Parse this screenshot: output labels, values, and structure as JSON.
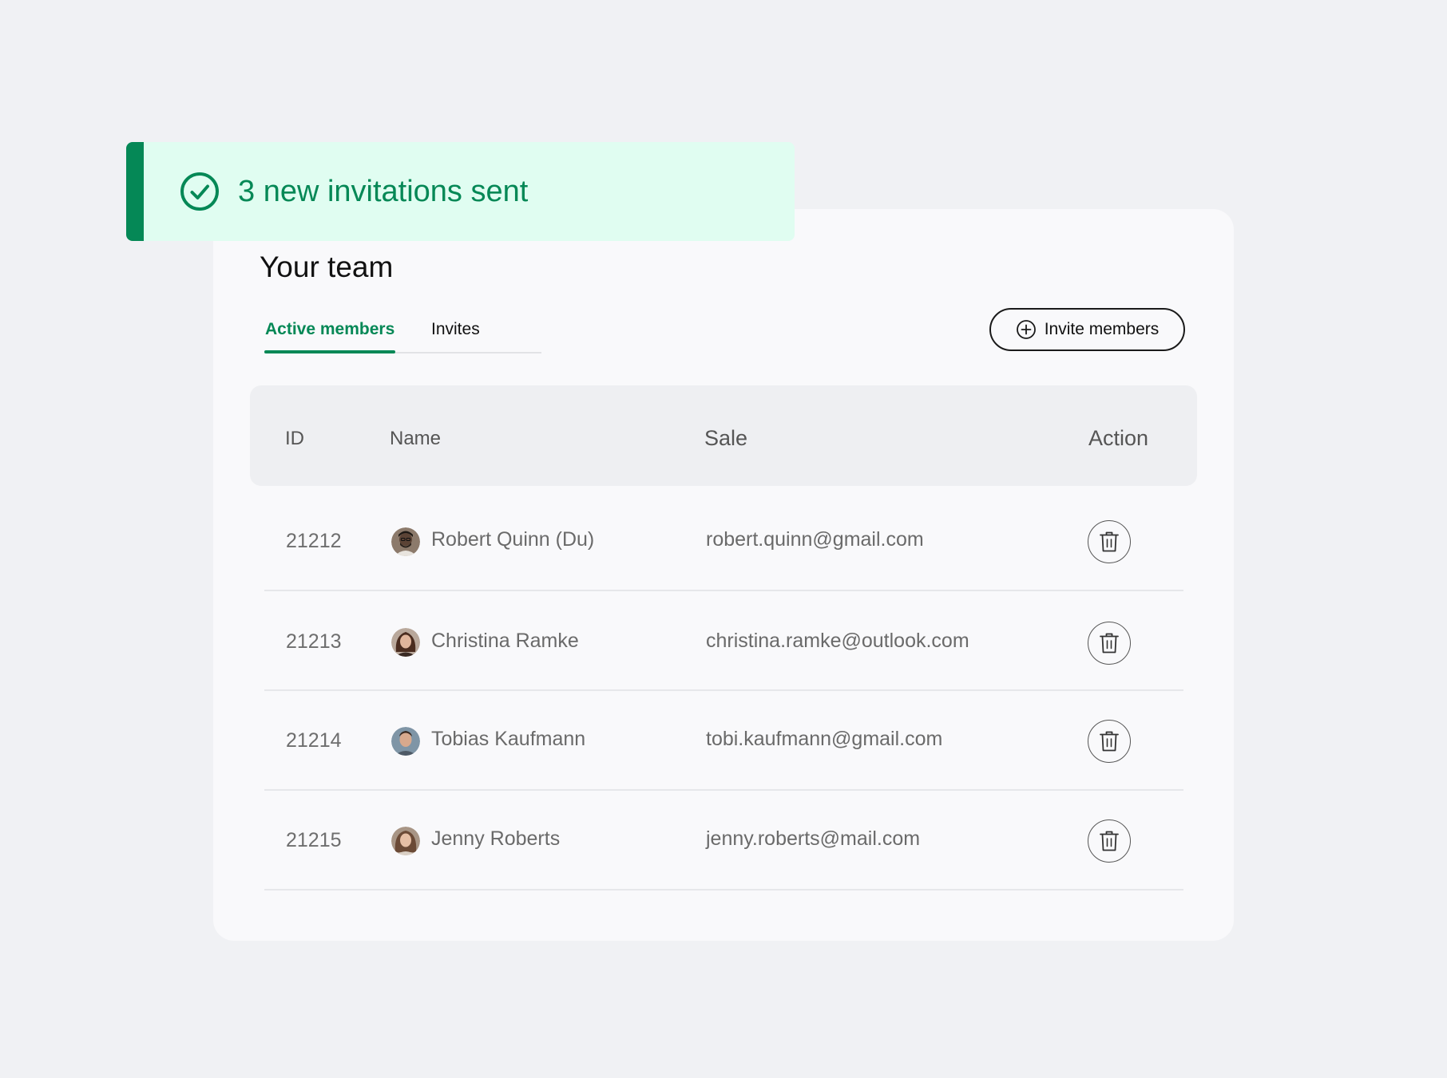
{
  "toast": {
    "message": "3 new invitations sent",
    "icon": "check-circle-icon",
    "accent_color": "#058856",
    "background_color": "#e0fdf1"
  },
  "team": {
    "title": "Your team",
    "tabs": [
      {
        "label": "Active members",
        "active": true
      },
      {
        "label": "Invites",
        "active": false
      }
    ],
    "invite_button": {
      "label": "Invite members",
      "icon": "plus-circle-icon"
    }
  },
  "table": {
    "headers": {
      "id": "ID",
      "name": "Name",
      "sale": "Sale",
      "action": "Action"
    },
    "rows": [
      {
        "id": "21212",
        "name": "Robert Quinn (Du)",
        "email": "robert.quinn@gmail.com",
        "avatar": "avatar-robert",
        "action_icon": "trash-icon"
      },
      {
        "id": "21213",
        "name": "Christina Ramke",
        "email": "christina.ramke@outlook.com",
        "avatar": "avatar-christina",
        "action_icon": "trash-icon"
      },
      {
        "id": "21214",
        "name": "Tobias Kaufmann",
        "email": "tobi.kaufmann@gmail.com",
        "avatar": "avatar-tobias",
        "action_icon": "trash-icon"
      },
      {
        "id": "21215",
        "name": "Jenny Roberts",
        "email": "jenny.roberts@mail.com",
        "avatar": "avatar-jenny",
        "action_icon": "trash-icon"
      }
    ]
  },
  "colors": {
    "brand_green": "#058856",
    "page_background": "#f0f1f4",
    "card_background": "#f9f9fb",
    "table_header_background": "#eeeff2"
  }
}
